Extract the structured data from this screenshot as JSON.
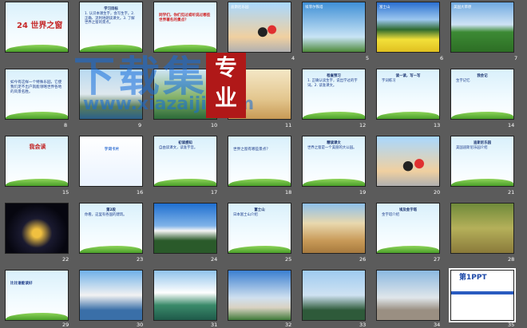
{
  "slides": [
    {
      "n": "",
      "text": "24 世界之窗"
    },
    {
      "n": "",
      "h": "学习目标",
      "text": "1. 认识本课生字，会写生字。2. 正确、流利地朗读课文。3. 了解世界之窗的景点。"
    },
    {
      "n": "",
      "text": "同学们，你们见过或听说过哪些世界著名的景点？"
    },
    {
      "n": "4",
      "label": "迪斯尼乐园"
    },
    {
      "n": "5",
      "label": "埃菲尔铁塔"
    },
    {
      "n": "6",
      "label": "富士山"
    },
    {
      "n": "7",
      "label": "美国大草原"
    },
    {
      "n": "8",
      "text": "如今有这样一个特殊乐园，它使我们足不出户就能领略世界各地的风景名胜。"
    },
    {
      "n": "9",
      "label": ""
    },
    {
      "n": "10",
      "label": ""
    },
    {
      "n": "11",
      "label": ""
    },
    {
      "n": "12",
      "h": "检查预习",
      "text": "1. 正确认读生字，说出学过的字词。2. 读准课文。"
    },
    {
      "n": "13",
      "h": "读一读，写一写",
      "text": "字词练习"
    },
    {
      "n": "14",
      "h": "我会记",
      "text": "生字记忆"
    },
    {
      "n": "15",
      "text": "我会读"
    },
    {
      "n": "16",
      "text": "字词卡片"
    },
    {
      "n": "17",
      "h": "初读感知",
      "text": "自由读课文，读准字音。"
    },
    {
      "n": "18",
      "text": "世界之窗有哪些景点？"
    },
    {
      "n": "19",
      "h": "精读课文",
      "text": "世界之窗是一个美丽的大公园。"
    },
    {
      "n": "20",
      "label": ""
    },
    {
      "n": "21",
      "h": "迪斯尼乐园",
      "text": "美国迪斯尼乐园介绍"
    },
    {
      "n": "22",
      "label": ""
    },
    {
      "n": "23",
      "h": "第2段",
      "text": "你看，这里有各国的建筑。"
    },
    {
      "n": "24",
      "label": ""
    },
    {
      "n": "25",
      "h": "富士山",
      "text": "日本富士山介绍"
    },
    {
      "n": "26",
      "label": ""
    },
    {
      "n": "27",
      "h": "埃及金字塔",
      "text": "金字塔介绍"
    },
    {
      "n": "28",
      "label": ""
    },
    {
      "n": "29",
      "text": "比比谁能读好"
    },
    {
      "n": "30",
      "label": ""
    },
    {
      "n": "31",
      "label": ""
    },
    {
      "n": "32",
      "label": ""
    },
    {
      "n": "33",
      "label": ""
    },
    {
      "n": "34",
      "label": ""
    },
    {
      "n": "35",
      "text": "第1PPT"
    }
  ],
  "watermark": {
    "main": "下载集",
    "url": "www.xiazaiji.com",
    "seal": "专业"
  }
}
